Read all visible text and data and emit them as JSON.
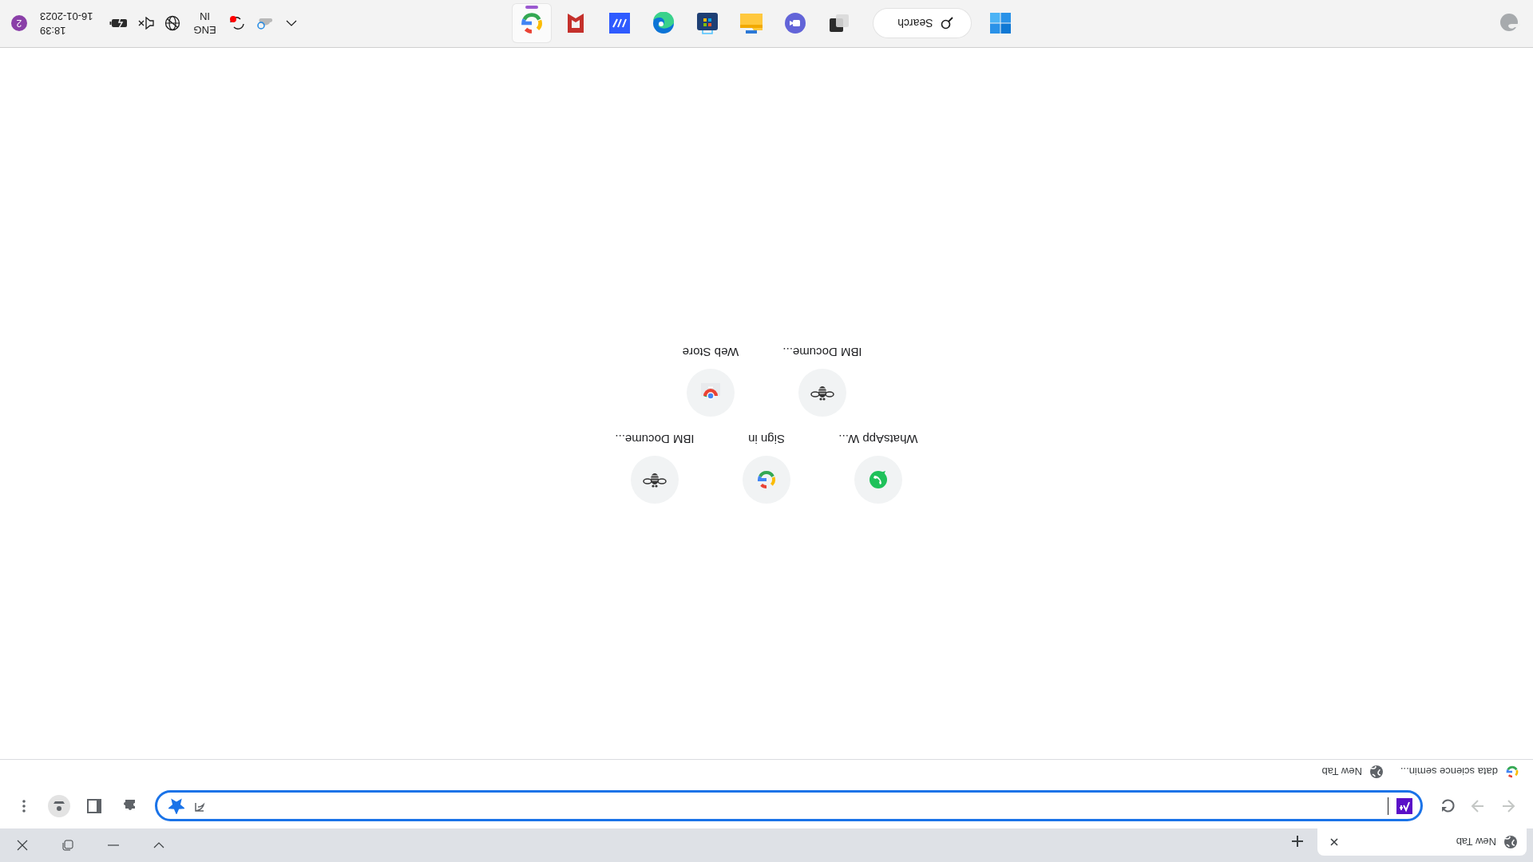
{
  "browser": {
    "tabs": [
      {
        "title": "New Tab",
        "selected": true
      }
    ],
    "nav_buttons": [
      {
        "kind": "back",
        "disabled": true
      },
      {
        "kind": "forward",
        "disabled": true
      },
      {
        "kind": "reload",
        "disabled": false
      }
    ],
    "address_bar": {
      "bookmarked": true
    },
    "bookmarks": [
      {
        "kind": "google",
        "label": "data science semin..."
      },
      {
        "kind": "globe",
        "label": "New Tab"
      }
    ]
  },
  "shortcuts": [
    {
      "kind": "whatsapp",
      "label": "WhatsApp W..."
    },
    {
      "kind": "google",
      "label": "Sign in"
    },
    {
      "kind": "ibm",
      "label": "IBM Docume..."
    },
    {
      "kind": "ibm",
      "label": "IBM Docume..."
    },
    {
      "kind": "webstore",
      "label": "Web Store"
    }
  ],
  "taskbar": {
    "search": {
      "placeholder": "Search"
    },
    "apps": [
      {
        "kind": "taskview",
        "selected": false
      },
      {
        "kind": "meet",
        "selected": false
      },
      {
        "kind": "explorer",
        "selected": false
      },
      {
        "kind": "store",
        "selected": false
      },
      {
        "kind": "edge",
        "selected": false
      },
      {
        "kind": "clipchamp",
        "selected": false
      },
      {
        "kind": "bookmark",
        "selected": false
      },
      {
        "kind": "chrome",
        "selected": true
      }
    ],
    "tray": {
      "language": "ENG",
      "region": "IN",
      "time": "18:39",
      "date": "16-01-2023",
      "notifications": "2"
    }
  }
}
